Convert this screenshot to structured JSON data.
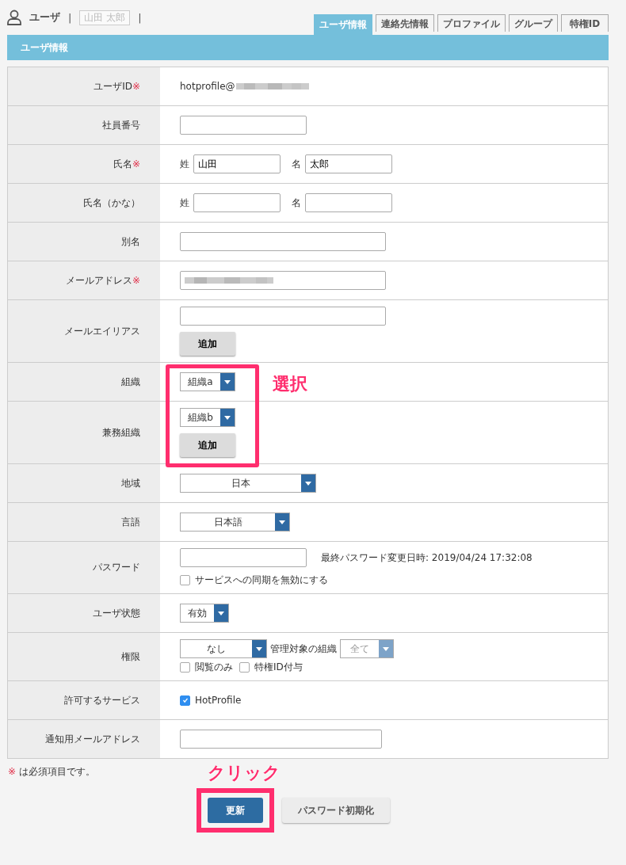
{
  "header": {
    "title": "ユーザ",
    "separator": "|",
    "user_name": "山田 太郎",
    "separator_end": "|"
  },
  "tabs": [
    {
      "label": "ユーザ情報",
      "selected": true
    },
    {
      "label": "連絡先情報",
      "selected": false
    },
    {
      "label": "プロファイル",
      "selected": false
    },
    {
      "label": "グループ",
      "selected": false
    },
    {
      "label": "特権ID",
      "selected": false
    }
  ],
  "section_title": "ユーザ情報",
  "rows": [
    {
      "label": "ユーザID",
      "required_mark": "※",
      "kind": "masked_text",
      "value": "hotprofile@"
    },
    {
      "label": "社員番号",
      "kind": "input"
    },
    {
      "label": "氏名",
      "required_mark": "※",
      "kind": "name",
      "fields": [
        {
          "prefix": "姓",
          "value": "山田"
        },
        {
          "prefix": "名",
          "value": "太郎"
        }
      ]
    },
    {
      "label": "氏名（かな）",
      "kind": "name",
      "fields": [
        {
          "prefix": "姓"
        },
        {
          "prefix": "名"
        }
      ]
    },
    {
      "label": "別名",
      "kind": "input"
    },
    {
      "label": "メールアドレス",
      "required_mark": "※",
      "kind": "masked_input"
    },
    {
      "label": "メールエイリアス",
      "kind": "alias",
      "button": "追加"
    },
    {
      "label": "組織",
      "kind": "select",
      "select": {
        "value": "組織a"
      },
      "annotation": "選択"
    },
    {
      "label": "兼務組織",
      "kind": "select",
      "select": {
        "value": "組織b"
      },
      "button": "追加"
    },
    {
      "label": "地域",
      "kind": "select",
      "select": {
        "value": "日本"
      }
    },
    {
      "label": "言語",
      "kind": "select",
      "select": {
        "value": "日本語"
      }
    },
    {
      "label": "パスワード",
      "kind": "password",
      "note": "最終パスワード変更日時: 2019/04/24 17:32:08",
      "checkboxes": [
        {
          "label": "サービスへの同期を無効にする",
          "checked": false
        }
      ]
    },
    {
      "label": "ユーザ状態",
      "kind": "select",
      "select": {
        "value": "有効"
      }
    },
    {
      "label": "権限",
      "kind": "authority",
      "select": {
        "value": "なし"
      },
      "scope_label": "管理対象の組織",
      "scope_select": {
        "value": "全て",
        "disabled": true
      },
      "checkboxes": [
        {
          "label": "閲覧のみ",
          "checked": false
        },
        {
          "label": "特権ID付与",
          "checked": false
        }
      ]
    },
    {
      "label": "許可するサービス",
      "kind": "checks",
      "checkboxes": [
        {
          "label": "HotProfile",
          "checked": true
        }
      ]
    },
    {
      "label": "通知用メールアドレス",
      "kind": "input"
    }
  ],
  "footnote": {
    "mark": "※",
    "text": "は必須項目です。"
  },
  "buttons": [
    {
      "label": "更新",
      "kind": "primary",
      "annotation": "クリック"
    },
    {
      "label": "パスワード初期化",
      "kind": "secondary"
    }
  ]
}
